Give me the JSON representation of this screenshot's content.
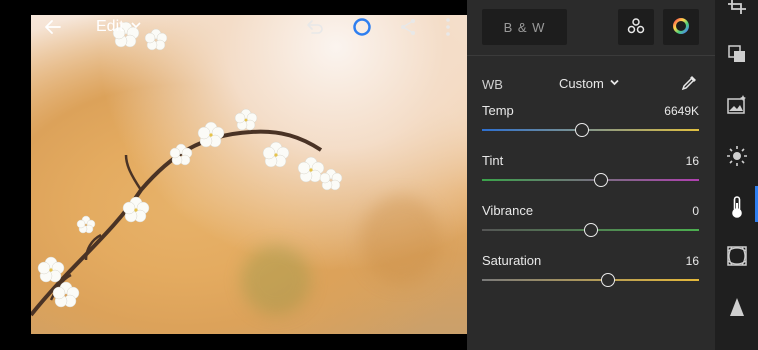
{
  "toolbar": {
    "back_icon": "arrow-left-icon",
    "title": "Edit",
    "title_menu_icon": "chevron-down-icon",
    "undo_icon": "undo-icon",
    "status_icon": "ring-icon",
    "share_icon": "share-icon",
    "more_icon": "vertical-dots-icon"
  },
  "panel": {
    "bw_label": "B & W",
    "presets_icon": "three-circles-icon",
    "color_mix_icon": "color-wheel-icon",
    "wb": {
      "label": "WB",
      "preset": "Custom",
      "eyedropper_icon": "eyedropper-icon"
    },
    "sliders": [
      {
        "label": "Temp",
        "value": "6649K",
        "level": 0.46,
        "gradient": [
          "#2d6fd0",
          "#e0c040"
        ]
      },
      {
        "label": "Tint",
        "value": "16",
        "level": 0.55,
        "gradient": [
          "#3aa34a",
          "#b040b0"
        ]
      },
      {
        "label": "Vibrance",
        "value": "0",
        "level": 0.5,
        "gradient": [
          "#555555",
          "#4caf50"
        ]
      },
      {
        "label": "Saturation",
        "value": "16",
        "level": 0.58,
        "gradient": [
          "#7a7a7a",
          "#e5b93a"
        ]
      }
    ]
  },
  "rail": {
    "items": [
      {
        "icon": "crop-icon"
      },
      {
        "icon": "layers-icon"
      },
      {
        "icon": "image-sparkle-icon"
      },
      {
        "icon": "sun-icon"
      },
      {
        "icon": "thermometer-icon",
        "active": true
      },
      {
        "icon": "vignette-frame-icon"
      },
      {
        "icon": "triangle-icon"
      }
    ]
  },
  "colors": {
    "accent": "#2f7ff0",
    "panel_bg": "#2b2b2b",
    "rail_bg": "#1f1f1f"
  }
}
